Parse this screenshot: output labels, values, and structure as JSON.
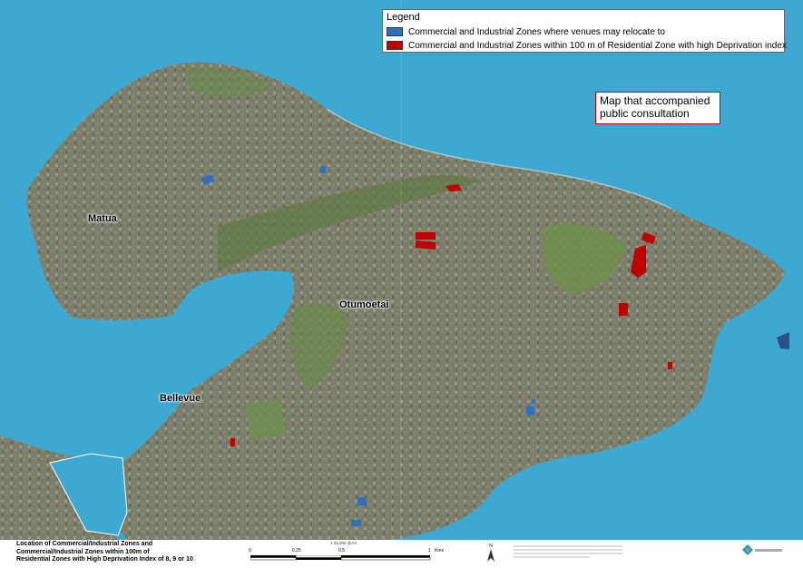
{
  "legend": {
    "title": "Legend",
    "items": [
      {
        "label": "Commercial and Industrial Zones where venues may relocate to",
        "color": "#2f6fbf"
      },
      {
        "label": "Commercial and Industrial Zones within 100 m of Residential Zone with high Deprivation index",
        "color": "#c00000"
      }
    ]
  },
  "note": {
    "line1": "Map that accompanied",
    "line2": "public consultation"
  },
  "places": {
    "matua": "Matua",
    "otumoetai": "Otumoetai",
    "bellevue": "Bellevue"
  },
  "footer": {
    "caption_line1": "Location of Commercial/Industrial Zones and",
    "caption_line2": "Commercial/Industrial Zones within 100m of",
    "caption_line3": "Residential Zones with High Deprivation Index of 8, 9 or 10",
    "scale_ratio": "1:15,000  @A4",
    "scale_ticks": [
      "0",
      "0.25",
      "0.5",
      "1"
    ],
    "scale_unit": "Kms",
    "north_label": "N"
  },
  "colors": {
    "water": "#3da9d3",
    "land": "#7a7b68",
    "vegetation": "#5f7a45",
    "blue_zone": "#2f6fbf",
    "red_zone": "#c00000"
  }
}
